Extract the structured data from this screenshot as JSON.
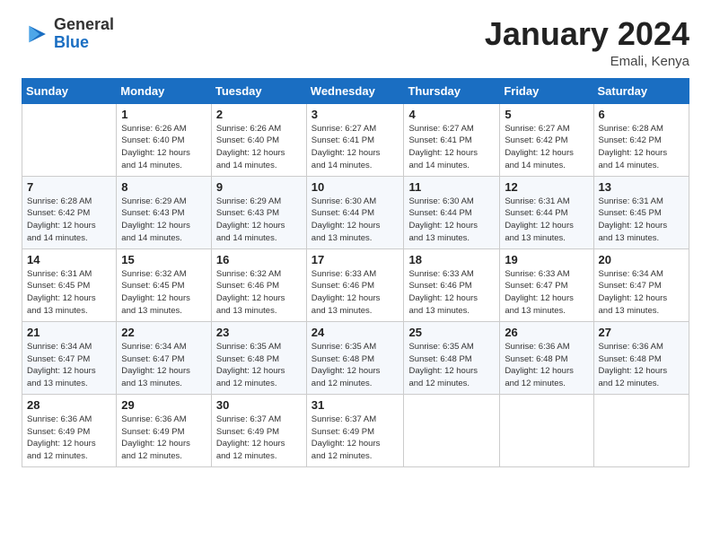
{
  "logo": {
    "general": "General",
    "blue": "Blue"
  },
  "title": {
    "month": "January 2024",
    "location": "Emali, Kenya"
  },
  "days_of_week": [
    "Sunday",
    "Monday",
    "Tuesday",
    "Wednesday",
    "Thursday",
    "Friday",
    "Saturday"
  ],
  "weeks": [
    [
      {
        "day": "",
        "info": ""
      },
      {
        "day": "1",
        "info": "Sunrise: 6:26 AM\nSunset: 6:40 PM\nDaylight: 12 hours\nand 14 minutes."
      },
      {
        "day": "2",
        "info": "Sunrise: 6:26 AM\nSunset: 6:40 PM\nDaylight: 12 hours\nand 14 minutes."
      },
      {
        "day": "3",
        "info": "Sunrise: 6:27 AM\nSunset: 6:41 PM\nDaylight: 12 hours\nand 14 minutes."
      },
      {
        "day": "4",
        "info": "Sunrise: 6:27 AM\nSunset: 6:41 PM\nDaylight: 12 hours\nand 14 minutes."
      },
      {
        "day": "5",
        "info": "Sunrise: 6:27 AM\nSunset: 6:42 PM\nDaylight: 12 hours\nand 14 minutes."
      },
      {
        "day": "6",
        "info": "Sunrise: 6:28 AM\nSunset: 6:42 PM\nDaylight: 12 hours\nand 14 minutes."
      }
    ],
    [
      {
        "day": "7",
        "info": ""
      },
      {
        "day": "8",
        "info": "Sunrise: 6:29 AM\nSunset: 6:43 PM\nDaylight: 12 hours\nand 14 minutes."
      },
      {
        "day": "9",
        "info": "Sunrise: 6:29 AM\nSunset: 6:43 PM\nDaylight: 12 hours\nand 14 minutes."
      },
      {
        "day": "10",
        "info": "Sunrise: 6:30 AM\nSunset: 6:44 PM\nDaylight: 12 hours\nand 13 minutes."
      },
      {
        "day": "11",
        "info": "Sunrise: 6:30 AM\nSunset: 6:44 PM\nDaylight: 12 hours\nand 13 minutes."
      },
      {
        "day": "12",
        "info": "Sunrise: 6:31 AM\nSunset: 6:44 PM\nDaylight: 12 hours\nand 13 minutes."
      },
      {
        "day": "13",
        "info": "Sunrise: 6:31 AM\nSunset: 6:45 PM\nDaylight: 12 hours\nand 13 minutes."
      }
    ],
    [
      {
        "day": "14",
        "info": ""
      },
      {
        "day": "15",
        "info": "Sunrise: 6:32 AM\nSunset: 6:45 PM\nDaylight: 12 hours\nand 13 minutes."
      },
      {
        "day": "16",
        "info": "Sunrise: 6:32 AM\nSunset: 6:46 PM\nDaylight: 12 hours\nand 13 minutes."
      },
      {
        "day": "17",
        "info": "Sunrise: 6:33 AM\nSunset: 6:46 PM\nDaylight: 12 hours\nand 13 minutes."
      },
      {
        "day": "18",
        "info": "Sunrise: 6:33 AM\nSunset: 6:46 PM\nDaylight: 12 hours\nand 13 minutes."
      },
      {
        "day": "19",
        "info": "Sunrise: 6:33 AM\nSunset: 6:47 PM\nDaylight: 12 hours\nand 13 minutes."
      },
      {
        "day": "20",
        "info": "Sunrise: 6:34 AM\nSunset: 6:47 PM\nDaylight: 12 hours\nand 13 minutes."
      }
    ],
    [
      {
        "day": "21",
        "info": ""
      },
      {
        "day": "22",
        "info": "Sunrise: 6:34 AM\nSunset: 6:47 PM\nDaylight: 12 hours\nand 13 minutes."
      },
      {
        "day": "23",
        "info": "Sunrise: 6:35 AM\nSunset: 6:48 PM\nDaylight: 12 hours\nand 12 minutes."
      },
      {
        "day": "24",
        "info": "Sunrise: 6:35 AM\nSunset: 6:48 PM\nDaylight: 12 hours\nand 12 minutes."
      },
      {
        "day": "25",
        "info": "Sunrise: 6:35 AM\nSunset: 6:48 PM\nDaylight: 12 hours\nand 12 minutes."
      },
      {
        "day": "26",
        "info": "Sunrise: 6:36 AM\nSunset: 6:48 PM\nDaylight: 12 hours\nand 12 minutes."
      },
      {
        "day": "27",
        "info": "Sunrise: 6:36 AM\nSunset: 6:48 PM\nDaylight: 12 hours\nand 12 minutes."
      }
    ],
    [
      {
        "day": "28",
        "info": "Sunrise: 6:36 AM\nSunset: 6:49 PM\nDaylight: 12 hours\nand 12 minutes."
      },
      {
        "day": "29",
        "info": "Sunrise: 6:36 AM\nSunset: 6:49 PM\nDaylight: 12 hours\nand 12 minutes."
      },
      {
        "day": "30",
        "info": "Sunrise: 6:37 AM\nSunset: 6:49 PM\nDaylight: 12 hours\nand 12 minutes."
      },
      {
        "day": "31",
        "info": "Sunrise: 6:37 AM\nSunset: 6:49 PM\nDaylight: 12 hours\nand 12 minutes."
      },
      {
        "day": "",
        "info": ""
      },
      {
        "day": "",
        "info": ""
      },
      {
        "day": "",
        "info": ""
      }
    ]
  ],
  "week7_sun": "Sunrise: 6:28 AM\nSunset: 6:42 PM\nDaylight: 12 hours\nand 14 minutes.",
  "week14_sun": "Sunrise: 6:31 AM\nSunset: 6:45 PM\nDaylight: 12 hours\nand 13 minutes.",
  "week21_sun": "Sunrise: 6:34 AM\nSunset: 6:47 PM\nDaylight: 12 hours\nand 13 minutes."
}
